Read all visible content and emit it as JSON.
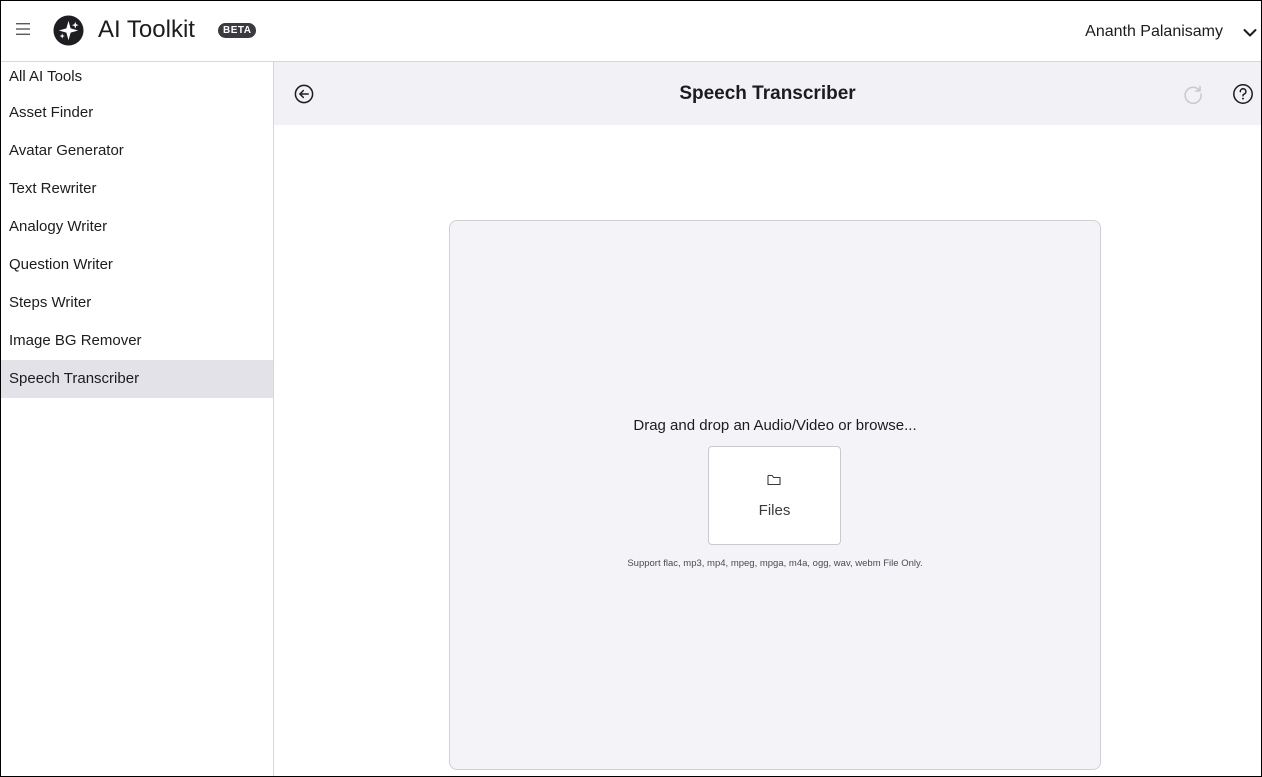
{
  "app": {
    "title": "AI Toolkit",
    "badge": "BETA",
    "user_name": "Ananth Palanisamy",
    "icons": {
      "menu": "hamburger-menu-icon",
      "logo": "sparkle-logo-icon",
      "user_menu": "chevron-down-icon"
    }
  },
  "sidebar": {
    "items": [
      {
        "label": "All AI Tools",
        "active": false
      },
      {
        "label": "Asset Finder",
        "active": false
      },
      {
        "label": "Avatar Generator",
        "active": false
      },
      {
        "label": "Text Rewriter",
        "active": false
      },
      {
        "label": "Analogy Writer",
        "active": false
      },
      {
        "label": "Question Writer",
        "active": false
      },
      {
        "label": "Steps Writer",
        "active": false
      },
      {
        "label": "Image BG Remover",
        "active": false
      },
      {
        "label": "Speech Transcriber",
        "active": true
      }
    ]
  },
  "header": {
    "title": "Speech Transcriber",
    "icons": {
      "back": "back-arrow-icon",
      "refresh": "refresh-icon",
      "help": "help-icon"
    }
  },
  "upload": {
    "prompt": "Drag and drop an Audio/Video or browse...",
    "button_label": "Files",
    "support_text": "Support flac, mp3, mp4, mpeg, mpga, m4a, ogg, wav, webm File Only.",
    "icon": "folder-icon"
  },
  "colors": {
    "header_bg": "#f2f2f6",
    "active_item_bg": "#e2e2e8",
    "panel_bg": "#f4f4f8",
    "badge_bg": "#3a3a3f"
  }
}
